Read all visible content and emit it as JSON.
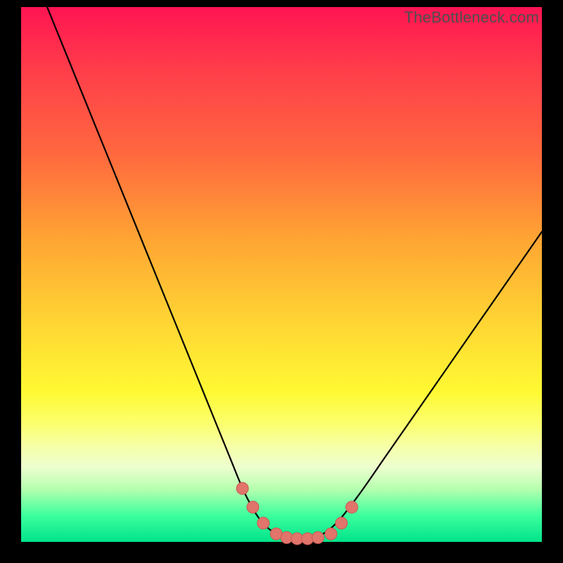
{
  "watermark": "TheBottleneck.com",
  "chart_data": {
    "type": "line",
    "title": "",
    "xlabel": "",
    "ylabel": "",
    "xlim": [
      0,
      100
    ],
    "ylim": [
      0,
      100
    ],
    "grid": false,
    "legend": false,
    "background_gradient": {
      "top": "#ff1452",
      "mid": "#ffe933",
      "bottom": "#00e38a"
    },
    "series": [
      {
        "name": "bottleneck-curve",
        "color": "#000000",
        "x": [
          5,
          10,
          15,
          20,
          25,
          30,
          35,
          40,
          43,
          46,
          49,
          52,
          55,
          58,
          61,
          65,
          70,
          75,
          80,
          85,
          90,
          95,
          100
        ],
        "values": [
          100,
          88,
          76,
          64,
          52,
          40,
          28,
          16,
          9,
          4,
          1.5,
          0.5,
          0.5,
          1.5,
          4,
          9,
          16,
          23,
          30,
          37,
          44,
          51,
          58
        ]
      }
    ],
    "markers": {
      "name": "threshold-points",
      "color": "#e1746b",
      "x": [
        42.5,
        44.5,
        46.5,
        49,
        51,
        53,
        55,
        57,
        59.5,
        61.5,
        63.5
      ],
      "values": [
        10,
        6.5,
        3.5,
        1.5,
        0.8,
        0.6,
        0.6,
        0.8,
        1.5,
        3.5,
        6.5
      ]
    }
  }
}
